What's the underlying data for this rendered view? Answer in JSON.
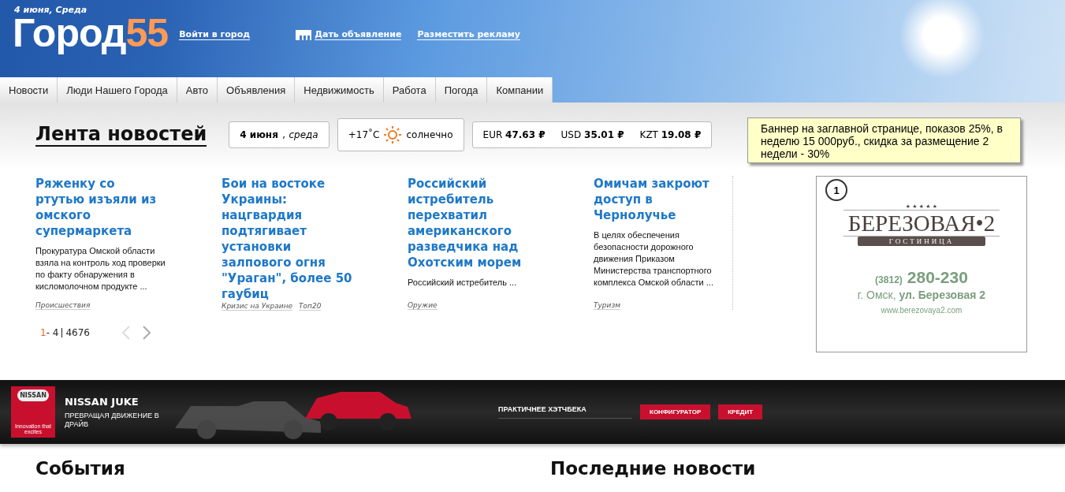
{
  "header": {
    "date": "4 июня, Среда",
    "logo_word": "Город",
    "logo_number": "55",
    "links": [
      {
        "label": "Войти в город",
        "kind": "plain"
      },
      {
        "label": "Дать объявление",
        "kind": "icon"
      },
      {
        "label": "Разместить рекламу",
        "kind": "plain"
      }
    ]
  },
  "tabs": [
    "Новости",
    "Люди Нашего Города",
    "Авто",
    "Объявления",
    "Недвижимость",
    "Работа",
    "Погода",
    "Компании"
  ],
  "feed": {
    "title": "Лента новостей",
    "date_bold": "4 июня",
    "date_rest": ", среда",
    "temperature": "+17˚C",
    "weather": "солнечно",
    "rates": [
      {
        "code": "EUR",
        "value": "47.63 ₽"
      },
      {
        "code": "USD",
        "value": "35.01 ₽"
      },
      {
        "code": "KZT",
        "value": "19.08 ₽"
      }
    ],
    "articles": [
      {
        "title": "Ряженку со ртутью изъяли из омского супермаркета",
        "text": "Прокуратура Омской области взяла на контроль ход проверки по факту обнаружения в кисломолочном продукте ...",
        "tags": [
          "Происшествия"
        ]
      },
      {
        "title": "Бои на востоке Украины: нацгвардия подтягивает установки залпового огня \"Ураган\", более 50 гаубиц",
        "tags": [
          "Кризис на Украине",
          "Топ20"
        ]
      },
      {
        "title": "Российский истребитель перехватил американского разведчика над Охотским морем",
        "text": "Российский истребитель ...",
        "tags": [
          "Оружие"
        ]
      },
      {
        "title": "Омичам закроют доступ в Чернолучье",
        "text": "В целях обеспечения безопасности дорожного движения Приказом Министерства транспортного комплекса Омской области ...",
        "tags": [
          "Туризм"
        ]
      }
    ],
    "pager": {
      "current": "1",
      "range": " - 4",
      "total": "4676"
    }
  },
  "note": "Баннер на заглавной странице, показов 25%, в неделю 15 000руб., скидка за размещение 2 недели - 30%",
  "ad": {
    "number": "1",
    "stars": "★ ★ ★ ★ ★",
    "name": "БЕРЕЗОВАЯ•2",
    "subtitle": "ГОСТИНИЦА",
    "code": "(3812)",
    "phone": "280-230",
    "city": "г. Омск,",
    "street": "ул. Березовая 2",
    "url": "www.berezovaya2.com"
  },
  "banner": {
    "brand": "NISSAN",
    "slogan": "Innovation that excites",
    "model": "NISSAN JUKE",
    "tagline": "ПРЕВРАЩАЯ ДВИЖЕНИЕ В ДРАЙВ",
    "claim": "ПРАКТИЧНЕЕ ХЭТЧБЕКА",
    "buttons": [
      "КОНФИГУРАТОР",
      "КРЕДИТ"
    ]
  },
  "sections": [
    "События",
    "Последние новости"
  ]
}
